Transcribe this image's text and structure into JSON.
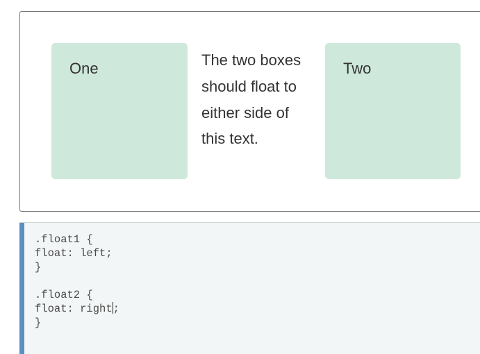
{
  "demo": {
    "box_one_label": "One",
    "box_two_label": "Two",
    "paragraph": "The two boxes should float to either side of this text."
  },
  "code": {
    "lines": [
      ".float1 {",
      "float: left;",
      "}",
      "",
      ".float2 {",
      "float: right",
      ";",
      "}"
    ]
  },
  "colors": {
    "box_background": "#cfe8dc",
    "code_background": "#f3f6f6",
    "code_accent_bar": "#5b8fc0"
  }
}
